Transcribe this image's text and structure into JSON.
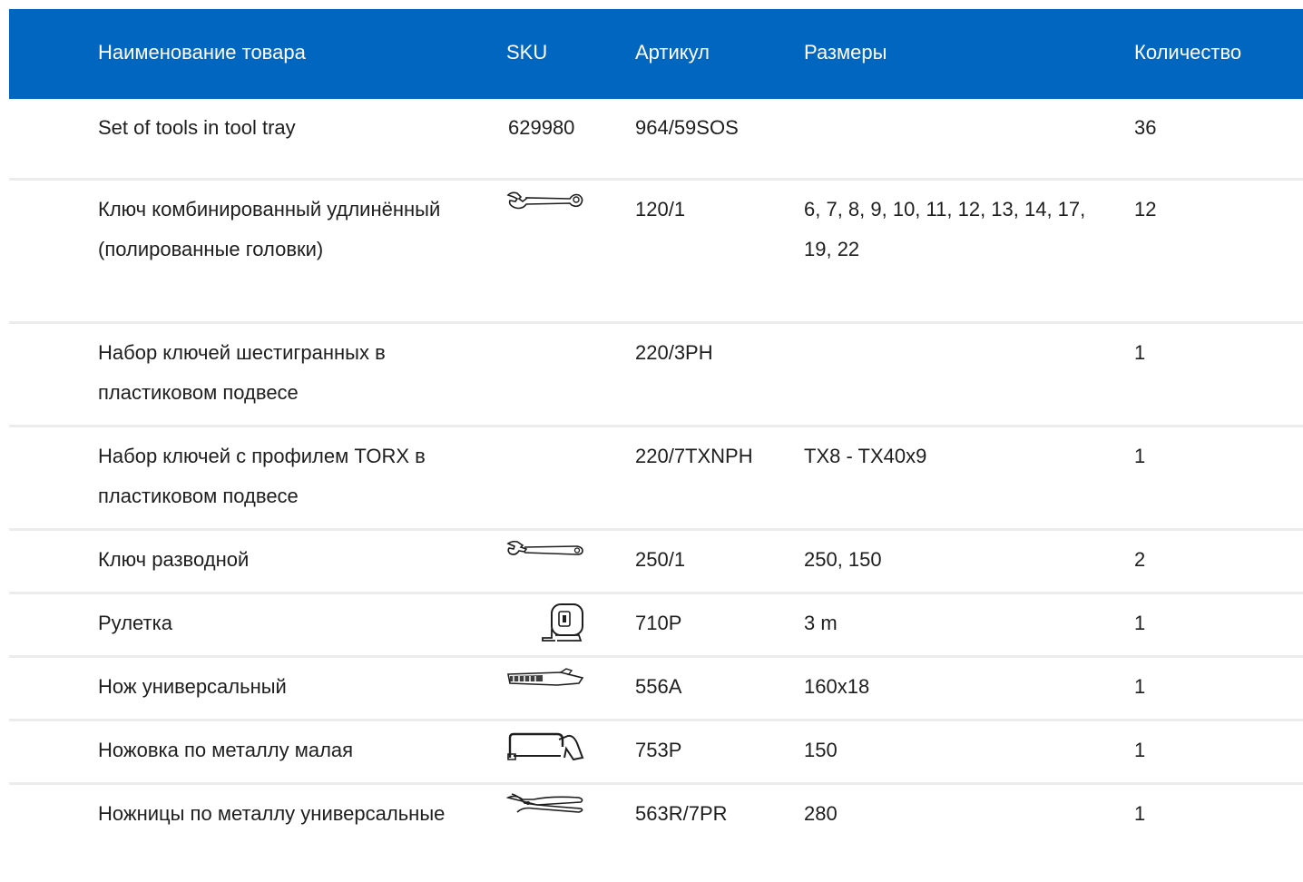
{
  "header": {
    "name_label": "Наименование товара",
    "sku_label": "SKU",
    "article_label": "Артикул",
    "sizes_label": "Размеры",
    "qty_label": "Количество"
  },
  "rows": [
    {
      "name": "Set of tools in tool tray",
      "sku": "629980",
      "article": "964/59SOS",
      "sizes": "",
      "qty": "36"
    },
    {
      "name": "Ключ комбинированный удлинённый (полированные головки)",
      "sku_icon": "combination-wrench-icon",
      "article": "120/1",
      "sizes": "6, 7, 8, 9, 10, 11, 12, 13, 14, 17, 19, 22",
      "qty": "12"
    },
    {
      "name": "Набор ключей шестигранных в пластиковом подвесе",
      "article": "220/3PH",
      "sizes": "",
      "qty": "1"
    },
    {
      "name": "Набор ключей с профилем TORX в пластиковом подвесе",
      "article": "220/7TXNPH",
      "sizes": "TX8 - TX40x9",
      "qty": "1"
    },
    {
      "name": "Ключ разводной",
      "sku_icon": "adjustable-wrench-icon",
      "article": "250/1",
      "sizes": "250, 150",
      "qty": "2"
    },
    {
      "name": "Рулетка",
      "sku_icon": "tape-measure-icon",
      "article": "710P",
      "sizes": "3 m",
      "qty": "1"
    },
    {
      "name": "Нож универсальный",
      "sku_icon": "utility-knife-icon",
      "article": "556A",
      "sizes": "160x18",
      "qty": "1"
    },
    {
      "name": "Ножовка по металлу малая",
      "sku_icon": "hacksaw-icon",
      "article": "753P",
      "sizes": "150",
      "qty": "1"
    },
    {
      "name": "Ножницы по металлу универсальные",
      "sku_icon": "metal-shears-icon",
      "article": "563R/7PR",
      "sizes": "280",
      "qty": "1"
    }
  ],
  "colors": {
    "header_bg": "#0066bf",
    "header_text": "#ffffff",
    "row_divider": "#ececec",
    "text": "#1e1e1e"
  }
}
